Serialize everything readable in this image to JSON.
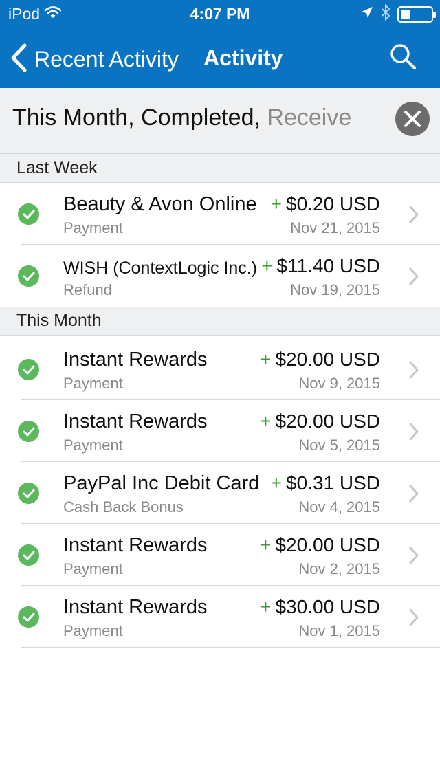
{
  "status_bar": {
    "carrier": "iPod",
    "time": "4:07 PM",
    "battery_level": 0.3
  },
  "nav": {
    "back_label": "Recent Activity",
    "title": "Activity"
  },
  "filter": {
    "text_main": "This Month, Completed, ",
    "text_faded": "Receive"
  },
  "sections": [
    {
      "title": "Last Week",
      "rows": [
        {
          "name": "Beauty & Avon Online",
          "type": "Payment",
          "plus": "+",
          "amount": "$0.20 USD",
          "date": "Nov 21, 2015"
        },
        {
          "name": "WISH (ContextLogic Inc.)",
          "type": "Refund",
          "plus": "+",
          "amount": "$11.40 USD",
          "date": "Nov 19, 2015"
        }
      ]
    },
    {
      "title": "This Month",
      "rows": [
        {
          "name": "Instant Rewards",
          "type": "Payment",
          "plus": "+",
          "amount": "$20.00 USD",
          "date": "Nov 9, 2015"
        },
        {
          "name": "Instant Rewards",
          "type": "Payment",
          "plus": "+",
          "amount": "$20.00 USD",
          "date": "Nov 5, 2015"
        },
        {
          "name": "PayPal Inc Debit Card",
          "type": "Cash Back Bonus",
          "plus": "+",
          "amount": "$0.31 USD",
          "date": "Nov 4, 2015"
        },
        {
          "name": "Instant Rewards",
          "type": "Payment",
          "plus": "+",
          "amount": "$20.00 USD",
          "date": "Nov 2, 2015"
        },
        {
          "name": "Instant Rewards",
          "type": "Payment",
          "plus": "+",
          "amount": "$30.00 USD",
          "date": "Nov 1, 2015"
        }
      ]
    }
  ],
  "colors": {
    "brand_blue": "#0a73c2",
    "status_green": "#5cb85c",
    "amount_plus_green": "#3a9e2e"
  },
  "icons": [
    "wifi-icon",
    "back-chevron-icon",
    "search-icon",
    "location-arrow-icon",
    "bluetooth-icon",
    "battery-icon",
    "close-icon",
    "check-icon",
    "chevron-right-icon"
  ]
}
